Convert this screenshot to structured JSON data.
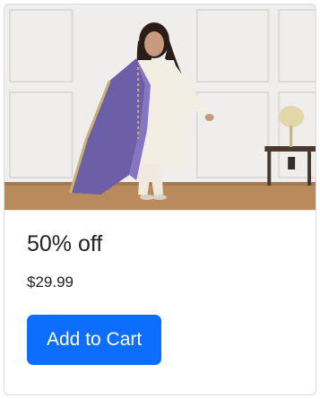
{
  "product_card": {
    "image_description_icon": "product-photo",
    "title": "50% off",
    "price": "$29.99",
    "cta_label": "Add to Cart"
  },
  "colors": {
    "button_bg": "#0d6efd",
    "button_text": "#ffffff",
    "text": "#222222",
    "dupatta": "#6c5fa8",
    "outfit": "#f1ece2"
  }
}
